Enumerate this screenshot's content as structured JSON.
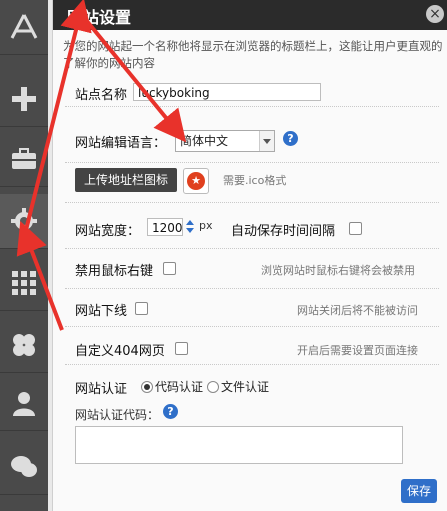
{
  "dialog": {
    "title": "网站设置",
    "close_label": "×",
    "description": "为您的网站起一个名称他将显示在浏览器的标题栏上，这能让用户更直观的了解你的网站内容"
  },
  "rail": {
    "items": [
      {
        "icon": "app-store-icon"
      },
      {
        "icon": "plus-icon"
      },
      {
        "icon": "briefcase-icon"
      },
      {
        "icon": "gear-icon"
      },
      {
        "icon": "grid-icon"
      },
      {
        "icon": "clover-icon"
      },
      {
        "icon": "user-icon"
      },
      {
        "icon": "chat-icon"
      }
    ]
  },
  "site_name": {
    "label": "站点名称",
    "value": "luckyboking"
  },
  "language": {
    "label": "网站编辑语言：",
    "selected": "简体中文",
    "help": "?"
  },
  "favicon": {
    "button": "上传地址栏图标",
    "hint": "需要.ico格式"
  },
  "width": {
    "label": "网站宽度：",
    "value": "1200",
    "unit": "px",
    "autosave_label": "自动保存时间间隔"
  },
  "right_click": {
    "label": "禁用鼠标右键",
    "hint": "浏览网站时鼠标右键将会被禁用"
  },
  "offline": {
    "label": "网站下线",
    "hint": "网站关闭后将不能被访问"
  },
  "custom404": {
    "label": "自定义404网页",
    "hint": "开启后需要设置页面连接"
  },
  "verify": {
    "label": "网站认证",
    "option_code": "代码认证",
    "option_file": "文件认证",
    "selected": "代码认证",
    "code_label": "网站认证代码：",
    "help": "?"
  },
  "footer": {
    "save_label": "保存"
  },
  "colors": {
    "accent": "#2f6fc9",
    "titlebar": "#2b2b2b",
    "arrow": "#e8322b"
  }
}
